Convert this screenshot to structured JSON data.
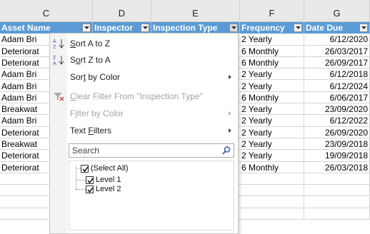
{
  "columns": [
    "C",
    "D",
    "E",
    "F",
    "G"
  ],
  "table": {
    "headers": [
      "Asset Name",
      "Inspector",
      "Inspection Type",
      "Frequency",
      "Date Due"
    ],
    "rows": [
      [
        "Adam Bri",
        "2 Yearly",
        "6/12/2020"
      ],
      [
        "Deteriorat",
        "6 Monthly",
        "26/03/2017"
      ],
      [
        "Deteriorat",
        "6 Monthly",
        "26/09/2017"
      ],
      [
        "Adam Bri",
        "2 Yearly",
        "6/12/2018"
      ],
      [
        "Adam Bri",
        "2 Yearly",
        "6/12/2024"
      ],
      [
        "Adam Bri",
        "6 Monthly",
        "6/06/2017"
      ],
      [
        "Breakwat",
        "2 Yearly",
        "23/09/2020"
      ],
      [
        "Adam Bri",
        "2 Yearly",
        "6/12/2022"
      ],
      [
        "Deteriorat",
        "2 Yearly",
        "26/09/2020"
      ],
      [
        "Breakwat",
        "2 Yearly",
        "23/09/2018"
      ],
      [
        "Deteriorat",
        "2 Yearly",
        "19/09/2018"
      ],
      [
        "Deteriorat",
        "6 Monthly",
        "26/03/2018"
      ]
    ]
  },
  "menu": {
    "sort_az": {
      "pre": "",
      "key": "S",
      "post": "ort A to Z"
    },
    "sort_za": {
      "pre": "S",
      "key": "o",
      "post": "rt Z to A"
    },
    "sort_color": {
      "pre": "Sor",
      "key": "t",
      "post": " by Color"
    },
    "clear_filter": {
      "pre": "",
      "key": "C",
      "post": "lear Filter From \"Inspection Type\""
    },
    "filter_color": {
      "pre": "F",
      "key": "i",
      "post": "lter by Color"
    },
    "text_filters": {
      "pre": "Text ",
      "key": "F",
      "post": "ilters"
    },
    "search_placeholder": "Search",
    "tree": [
      "(Select All)",
      "Level 1",
      "Level 2"
    ]
  },
  "colors": {
    "header_bg": "#5b9bd5",
    "header_text": "#ffffff"
  }
}
